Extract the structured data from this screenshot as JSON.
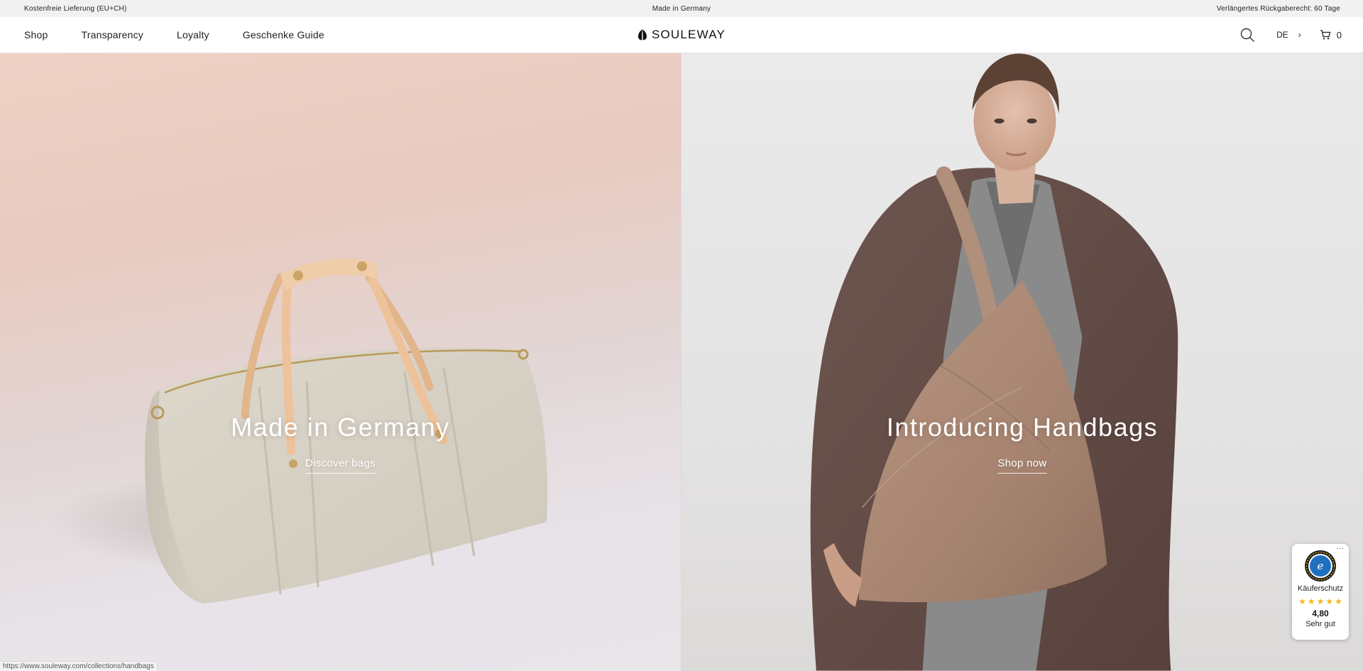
{
  "announcement": {
    "left": "Kostenfreie Lieferung (EU+CH)",
    "center": "Made in Germany",
    "right": "Verlängertes Rückgaberecht: 60 Tage"
  },
  "header": {
    "nav": {
      "shop": "Shop",
      "transparency": "Transparency",
      "loyalty": "Loyalty",
      "gift_guide": "Geschenke Guide"
    },
    "logo": "SOULEWAY",
    "language": "DE",
    "lang_chevron": "›",
    "cart_count": "0"
  },
  "hero": {
    "left": {
      "heading": "Made in Germany",
      "cta": "Discover bags"
    },
    "right": {
      "heading": "Introducing Handbags",
      "cta": "Shop now"
    }
  },
  "trust_badge": {
    "more": "···",
    "label": "Käuferschutz",
    "stars": 5,
    "rating": "4,80",
    "verdict": "Sehr gut"
  },
  "status_bar": {
    "url": "https://www.souleway.com/collections/handbags"
  },
  "colors": {
    "accent_star": "#f5b81b",
    "announcement_bg": "#f1f1f1",
    "text": "#222222"
  },
  "icons": {
    "search": "search-icon",
    "cart": "cart-icon",
    "logo_mark": "souleway-logo-icon",
    "seal": "trusted-shops-seal-icon"
  }
}
